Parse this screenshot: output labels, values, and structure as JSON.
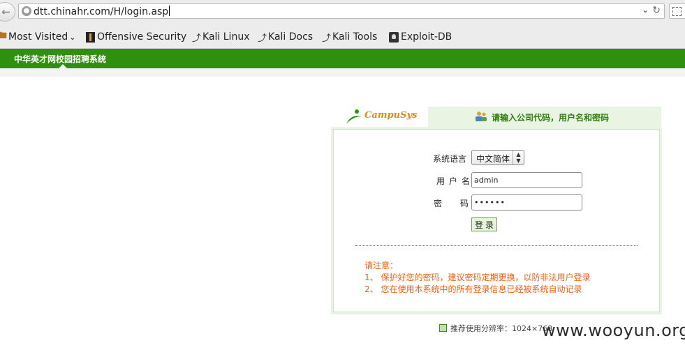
{
  "browser": {
    "url": "dtt.chinahr.com/H/login.asp",
    "bookmarks": [
      {
        "label": "Most Visited",
        "icon": "folder-icon"
      },
      {
        "label": "Offensive Security",
        "icon": "offsec-icon"
      },
      {
        "label": "Kali Linux",
        "icon": "kali-dragon-icon"
      },
      {
        "label": "Kali Docs",
        "icon": "kali-dragon-icon"
      },
      {
        "label": "Kali Tools",
        "icon": "kali-dragon-icon"
      },
      {
        "label": "Exploit-DB",
        "icon": "exploitdb-icon"
      }
    ]
  },
  "site": {
    "title": "中华英才网校园招聘系统",
    "brand_color": "#2f8f0f"
  },
  "login": {
    "logo_text": "CampuSys",
    "heading": "请输入公司代码，用户名和密码",
    "language_label": "系统语言",
    "language_value": "中文简体",
    "username_label": "用户名",
    "username_value": "admin",
    "password_label": "密码",
    "password_value": "••••••",
    "submit_label": "登录",
    "notice_color": "#f06010",
    "notice_title": "请注意：",
    "notices": [
      "1、  保护好您的密码，建议密码定期更换，以防非法用户登录",
      "2、  您在使用本系统中的所有登录信息已经被系统自动记录"
    ]
  },
  "footer": {
    "resolution_note": "推荐使用分辨率：1024×768"
  },
  "watermark": "www.wooyun.org"
}
